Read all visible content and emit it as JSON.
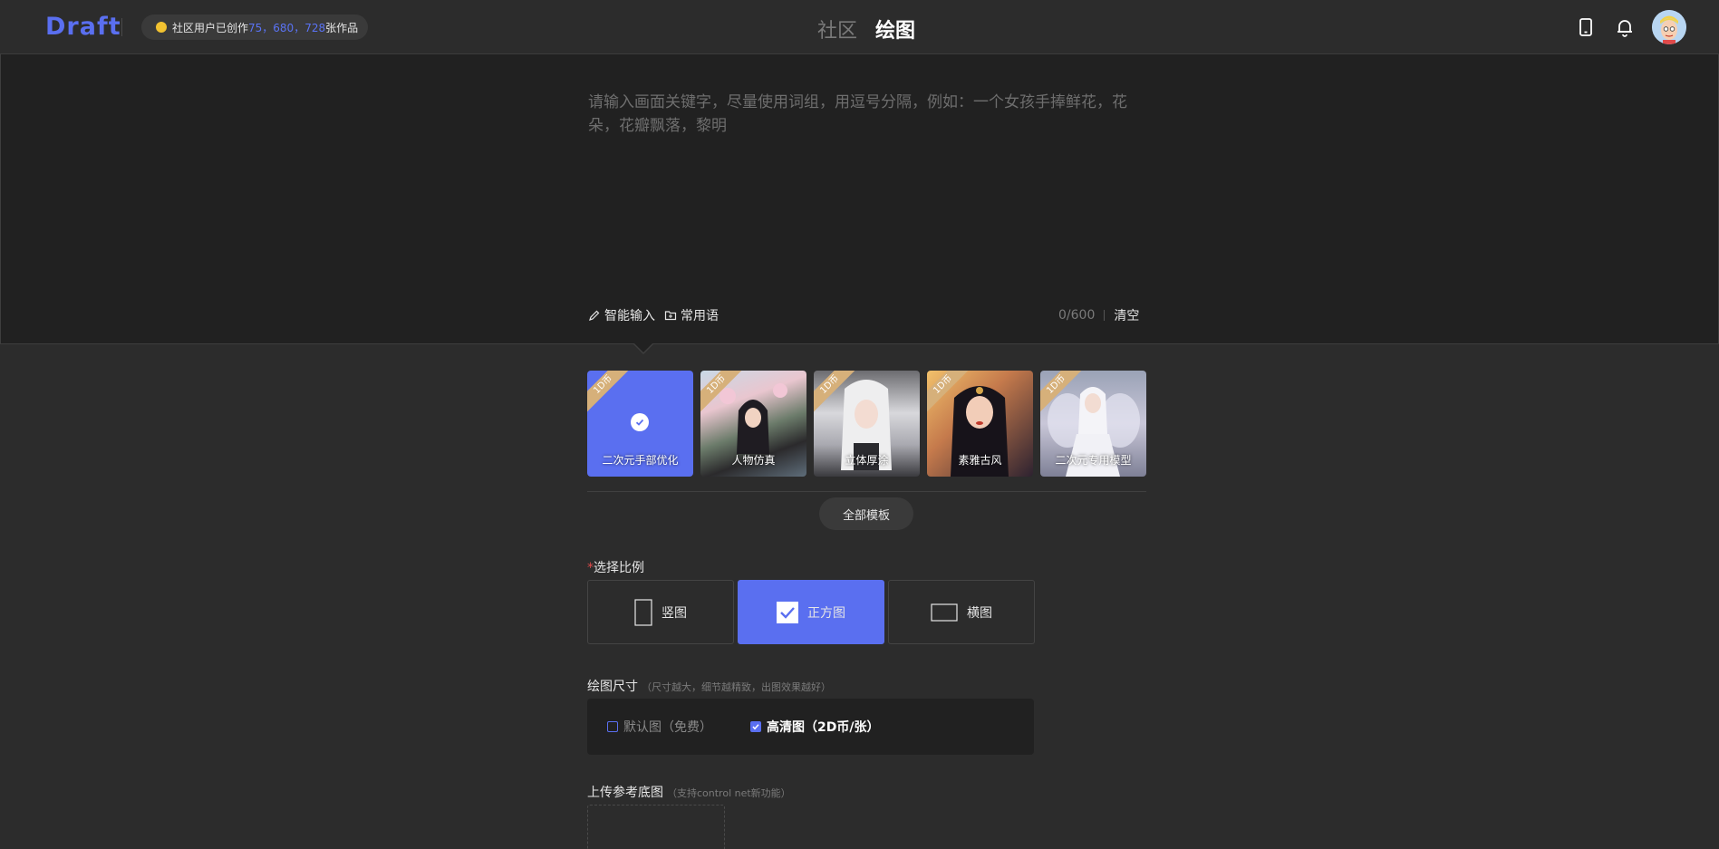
{
  "header": {
    "logo": "Draft",
    "community_pill": {
      "prefix": "社区用户已创作",
      "count": "75，680，728",
      "suffix": "张作品"
    },
    "tabs": [
      {
        "label": "社区",
        "active": false
      },
      {
        "label": "绘图",
        "active": true
      }
    ],
    "icons": [
      "tablet-icon",
      "bell-icon",
      "avatar"
    ]
  },
  "prompt": {
    "placeholder": "请输入画面关键字，尽量使用词组，用逗号分隔，例如：一个女孩手捧鲜花，花朵，花瓣飘落，黎明",
    "value": "",
    "tools": {
      "smart_input": "智能输入",
      "common_phrases": "常用语"
    },
    "counter": "0/600",
    "clear": "清空"
  },
  "templates": {
    "items": [
      {
        "label": "二次元手部优化",
        "badge": "1D币",
        "selected": true
      },
      {
        "label": "人物仿真",
        "badge": "1D币",
        "selected": false
      },
      {
        "label": "立体厚涂",
        "badge": "1D币",
        "selected": false
      },
      {
        "label": "素雅古风",
        "badge": "1D币",
        "selected": false
      },
      {
        "label": "二次元专用模型",
        "badge": "1D币",
        "selected": false
      }
    ],
    "all_button": "全部模板"
  },
  "ratio": {
    "label": "选择比例",
    "required_mark": "*",
    "options": [
      {
        "label": "竖图",
        "selected": false
      },
      {
        "label": "正方图",
        "selected": true
      },
      {
        "label": "横图",
        "selected": false
      }
    ]
  },
  "size": {
    "label": "绘图尺寸",
    "hint": "（尺寸越大，细节越精致，出图效果越好）",
    "options": [
      {
        "label": "默认图（免费）",
        "checked": false
      },
      {
        "label": "高清图（2D币/张）",
        "checked": true
      }
    ]
  },
  "upload": {
    "label": "上传参考底图",
    "hint": "（支持control net新功能）"
  },
  "colors": {
    "accent": "#5a6ff0",
    "badge": "#d6b07a",
    "background": "#2c2c2c",
    "panel": "#212121"
  }
}
